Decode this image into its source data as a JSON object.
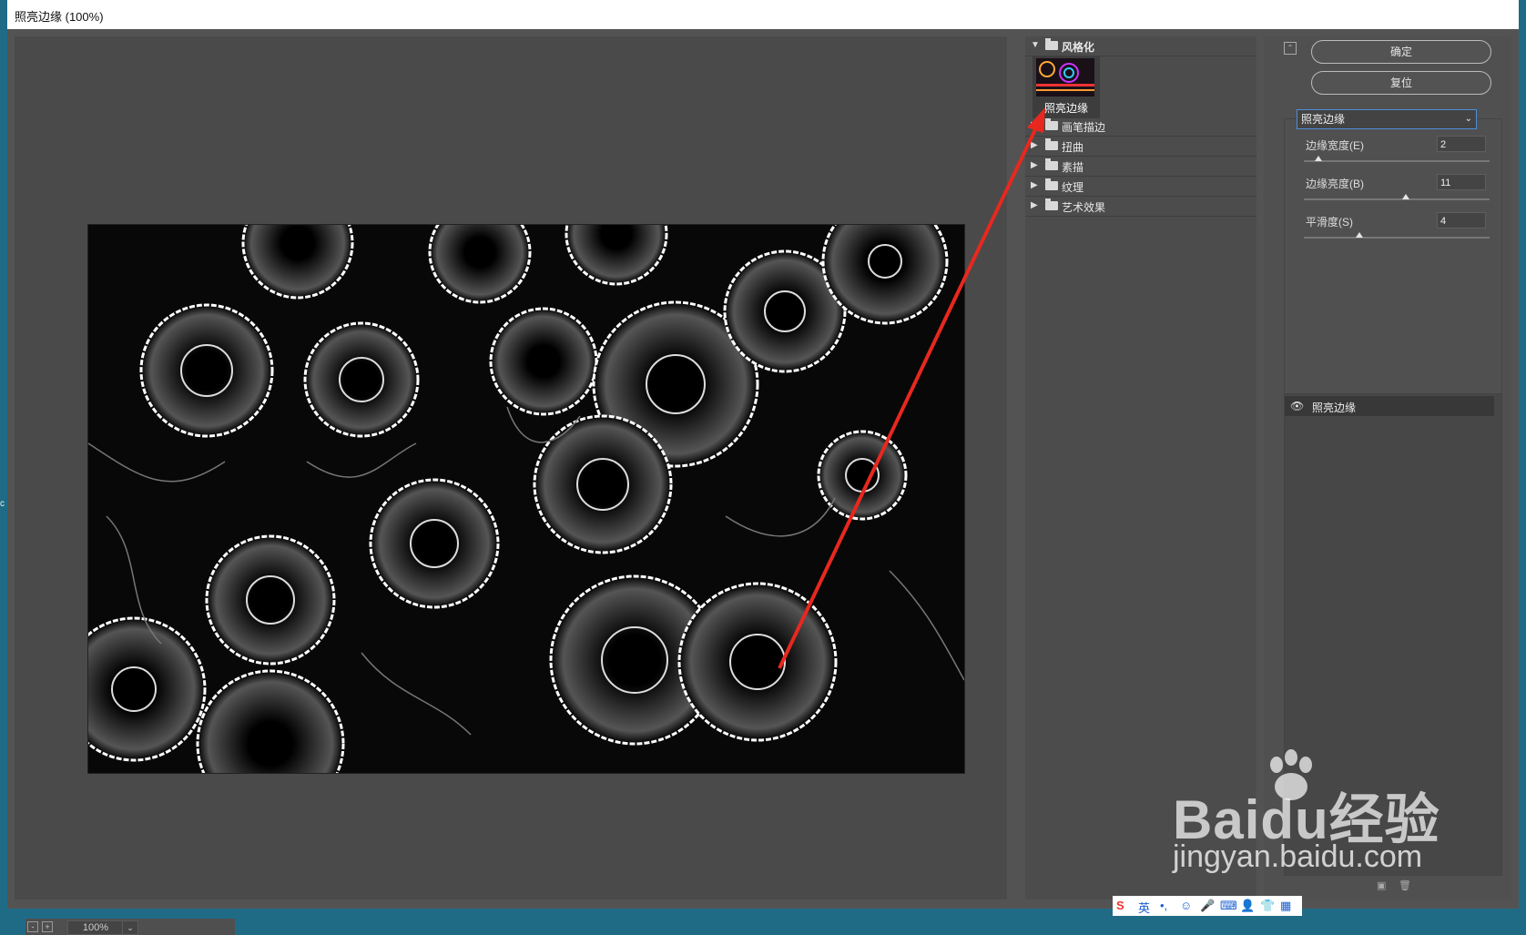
{
  "window": {
    "title": "照亮边缘 (100%)"
  },
  "zoom": {
    "value": "100%",
    "minus": "-",
    "plus": "+"
  },
  "gallery": {
    "open_category": "风格化",
    "selected_filter": "照亮边缘",
    "categories": [
      "画笔描边",
      "扭曲",
      "素描",
      "纹理",
      "艺术效果"
    ]
  },
  "buttons": {
    "ok": "确定",
    "reset": "复位"
  },
  "filter_select": {
    "value": "照亮边缘"
  },
  "params": [
    {
      "label": "边缘宽度(E)",
      "value": "2",
      "level": 0.08
    },
    {
      "label": "边缘亮度(B)",
      "value": "11",
      "level": 0.55
    },
    {
      "label": "平滑度(S)",
      "value": "4",
      "level": 0.3
    }
  ],
  "layers": {
    "item": "照亮边缘"
  },
  "ime": {
    "lang": "英"
  },
  "watermark": {
    "brand": "Baidu经验",
    "url": "jingyan.baidu.com"
  },
  "colors": {
    "accent_red": "#e8281f",
    "select_border": "#4d8edb"
  }
}
